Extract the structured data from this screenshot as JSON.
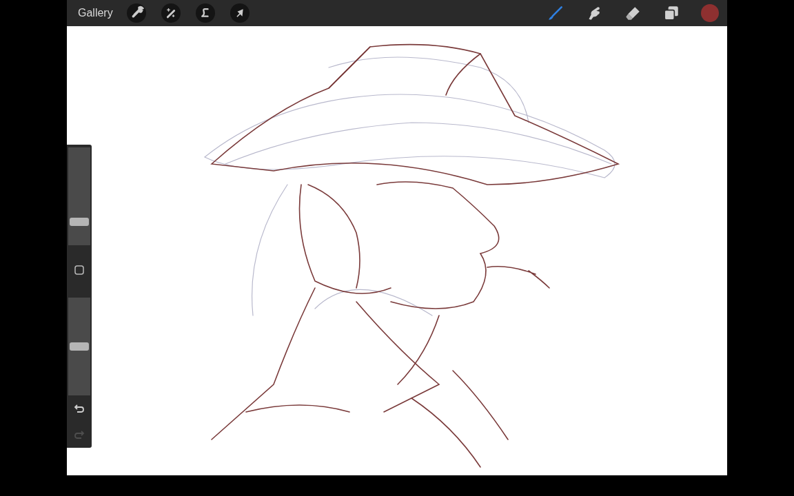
{
  "toolbar": {
    "gallery": "Gallery",
    "actions": [
      {
        "kind": "wrench"
      },
      {
        "kind": "wand"
      },
      {
        "kind": "selection"
      },
      {
        "kind": "transform"
      }
    ],
    "tools": [
      {
        "kind": "brush",
        "selected": true
      },
      {
        "kind": "smudge",
        "selected": false
      },
      {
        "kind": "eraser",
        "selected": false
      },
      {
        "kind": "layers",
        "selected": false
      }
    ],
    "color": "#8e3030"
  },
  "sidebar": {
    "sliders": [
      {
        "level": 0.24
      },
      {
        "level": 0.5
      }
    ],
    "undo": {
      "disabled": false
    },
    "redo": {
      "disabled": true
    }
  }
}
